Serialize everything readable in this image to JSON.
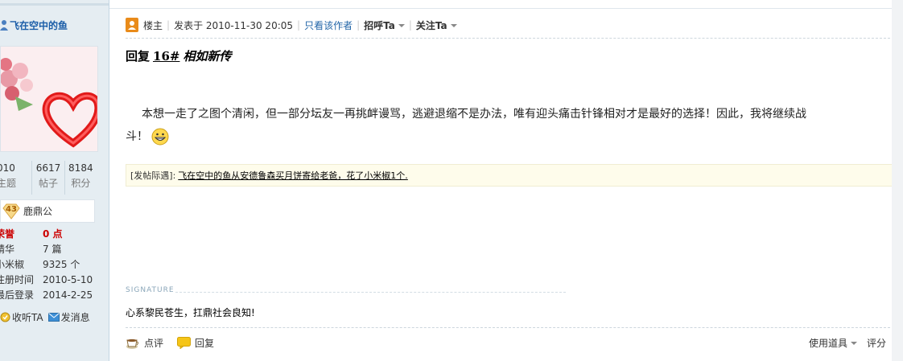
{
  "sidebar": {
    "username": "飞在空中的鱼",
    "stats": [
      {
        "num": "010",
        "label": "主题"
      },
      {
        "num": "6617",
        "label": "帖子"
      },
      {
        "num": "8184",
        "label": "积分"
      }
    ],
    "rank": {
      "level": "43",
      "name": "鹿鼎公"
    },
    "fields": [
      {
        "key": "荣誉",
        "value": "0 点"
      },
      {
        "key": "精华",
        "value": "7 篇"
      },
      {
        "key": "小米椒",
        "value": "9325 个"
      },
      {
        "key": "注册时间",
        "value": "2010-5-10"
      },
      {
        "key": "最后登录",
        "value": "2014-2-25"
      }
    ],
    "actions": {
      "follow": "收听TA",
      "message": "发消息"
    }
  },
  "post": {
    "author_tag": "楼主",
    "posted": "发表于 2010-11-30 20:05",
    "only_author": "只看该作者",
    "greet": "招呼Ta",
    "follow": "关注Ta",
    "title": {
      "prefix": "回复",
      "floor": "16#",
      "target": "相如新传"
    },
    "body_line1": "本想一走了之图个清闲，但一部分坛友一再挑衅谩骂，逃避退缩不是办法，唯有迎头痛击针锋相对才是最好的选择！因此，我将继续战",
    "body_line2": "斗！",
    "notice": {
      "label": "[发帖际遇]:",
      "text": "飞在空中的鱼从安德鲁森买月饼寄给老爸，花了小米椒1个."
    },
    "signature_label": "SIGNATURE",
    "signature_text": "心系黎民苍生，扛鼎社会良知!",
    "buttons": {
      "rate": "点评",
      "reply": "回复",
      "tools": "使用道具",
      "score": "评分"
    }
  }
}
